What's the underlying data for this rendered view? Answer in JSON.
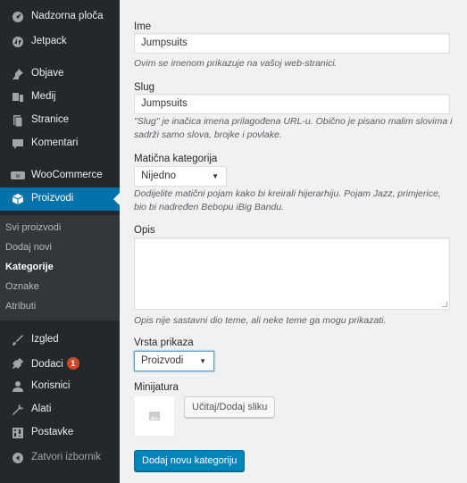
{
  "sidebar": {
    "items": [
      {
        "label": "Nadzorna ploča",
        "icon": "dashboard-icon"
      },
      {
        "label": "Jetpack",
        "icon": "jetpack-icon"
      },
      {
        "label": "Objave",
        "icon": "pin-icon"
      },
      {
        "label": "Medij",
        "icon": "media-icon"
      },
      {
        "label": "Stranice",
        "icon": "pages-icon"
      },
      {
        "label": "Komentari",
        "icon": "comments-icon"
      },
      {
        "label": "WooCommerce",
        "icon": "woocommerce-icon"
      },
      {
        "label": "Proizvodi",
        "icon": "products-icon"
      },
      {
        "label": "Izgled",
        "icon": "appearance-icon"
      },
      {
        "label": "Dodaci",
        "icon": "plugins-icon",
        "badge": "1"
      },
      {
        "label": "Korisnici",
        "icon": "users-icon"
      },
      {
        "label": "Alati",
        "icon": "tools-icon"
      },
      {
        "label": "Postavke",
        "icon": "settings-icon"
      },
      {
        "label": "Zatvori izbornik",
        "icon": "collapse-icon"
      }
    ],
    "submenu": [
      "Svi proizvodi",
      "Dodaj novi",
      "Kategorije",
      "Oznake",
      "Atributi"
    ],
    "active_item": "Proizvodi",
    "current_submenu": "Kategorije"
  },
  "form": {
    "name_label": "Ime",
    "name_value": "Jumpsuits",
    "name_desc": "Ovim se imenom prikazuje na vašoj web-stranici.",
    "slug_label": "Slug",
    "slug_value": "Jumpsuits",
    "slug_desc": "\"Slug\" je inačica imena prilagođena URL-u. Obično je pisano malim slovima i sadrži samo slova, brojke i povlake.",
    "parent_label": "Matična kategorija",
    "parent_value": "Nijedno",
    "parent_desc": "Dodijelite matični pojam kako bi kreirali hijerarhiju. Pojam Jazz, primjerice, bio bi nadređen Bebopu iBig Bandu.",
    "desc_label": "Opis",
    "desc_desc": "Opis nije sastavni dio teme, ali neke teme ga mogu prikazati.",
    "display_label": "Vrsta prikaza",
    "display_value": "Proizvodi",
    "thumb_label": "Minijatura",
    "upload_button": "Učitaj/Dodaj sliku",
    "submit_button": "Dodaj novu kategoriju"
  },
  "colors": {
    "sidebar_bg": "#23282d",
    "submenu_bg": "#32373c",
    "accent": "#0073aa",
    "primary_button": "#0085ba",
    "badge": "#ca4a1f"
  }
}
